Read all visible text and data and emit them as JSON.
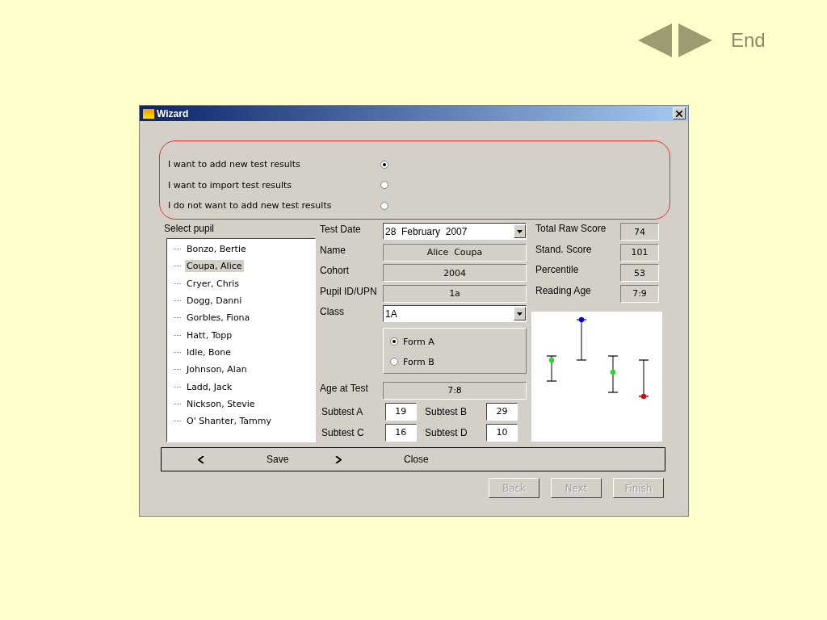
{
  "nav": {
    "end": "End"
  },
  "window": {
    "title": "Wizard"
  },
  "options": [
    {
      "label": "I want to add new test results",
      "selected": true
    },
    {
      "label": "I want to import test results",
      "selected": false
    },
    {
      "label": "I do not want to add new test results",
      "selected": false
    }
  ],
  "pupil_list": {
    "label": "Select pupil",
    "items": [
      {
        "name": "Bonzo, Bertie",
        "selected": false
      },
      {
        "name": "Coupa, Alice",
        "selected": true
      },
      {
        "name": "Cryer, Chris",
        "selected": false
      },
      {
        "name": "Dogg, Danni",
        "selected": false
      },
      {
        "name": "Gorbles, Fiona",
        "selected": false
      },
      {
        "name": "Hatt, Topp",
        "selected": false
      },
      {
        "name": "Idle, Bone",
        "selected": false
      },
      {
        "name": "Johnson, Alan",
        "selected": false
      },
      {
        "name": "Ladd, Jack",
        "selected": false
      },
      {
        "name": "Nickson, Stevie",
        "selected": false
      },
      {
        "name": "O' Shanter, Tammy",
        "selected": false
      }
    ]
  },
  "fields": [
    {
      "kind": "dropdown",
      "label": "Test Date",
      "value": "28  February  2007"
    },
    {
      "kind": "readonly",
      "label": "Name",
      "value": "Alice  Coupa"
    },
    {
      "kind": "readonly",
      "label": "Cohort",
      "value": "2004"
    },
    {
      "kind": "readonly",
      "label": "Pupil ID/UPN",
      "value": "1a"
    },
    {
      "kind": "dropdown",
      "label": "Class",
      "value": "1A"
    }
  ],
  "forms": [
    {
      "label": "Form A",
      "selected": true
    },
    {
      "label": "Form B",
      "selected": false
    }
  ],
  "age_at_test": {
    "label": "Age at Test",
    "value": "7:8"
  },
  "subtests": [
    {
      "label": "Subtest A",
      "value": "19"
    },
    {
      "label": "Subtest B",
      "value": "29"
    },
    {
      "label": "Subtest C",
      "value": "16"
    },
    {
      "label": "Subtest D",
      "value": "10"
    }
  ],
  "scores": [
    {
      "label": "Total Raw Score",
      "value": "74"
    },
    {
      "label": "Stand. Score",
      "value": "101"
    },
    {
      "label": "Percentile",
      "value": "53"
    },
    {
      "label": "Reading Age",
      "value": "7:9"
    }
  ],
  "toolbar": [
    {
      "kind": "left",
      "label": "Save"
    },
    {
      "kind": "right",
      "label": "Close"
    }
  ],
  "buttons": [
    {
      "label": "Back",
      "disabled": true
    },
    {
      "label": "Next",
      "disabled": true
    },
    {
      "label": "Finish",
      "disabled": true
    }
  ]
}
